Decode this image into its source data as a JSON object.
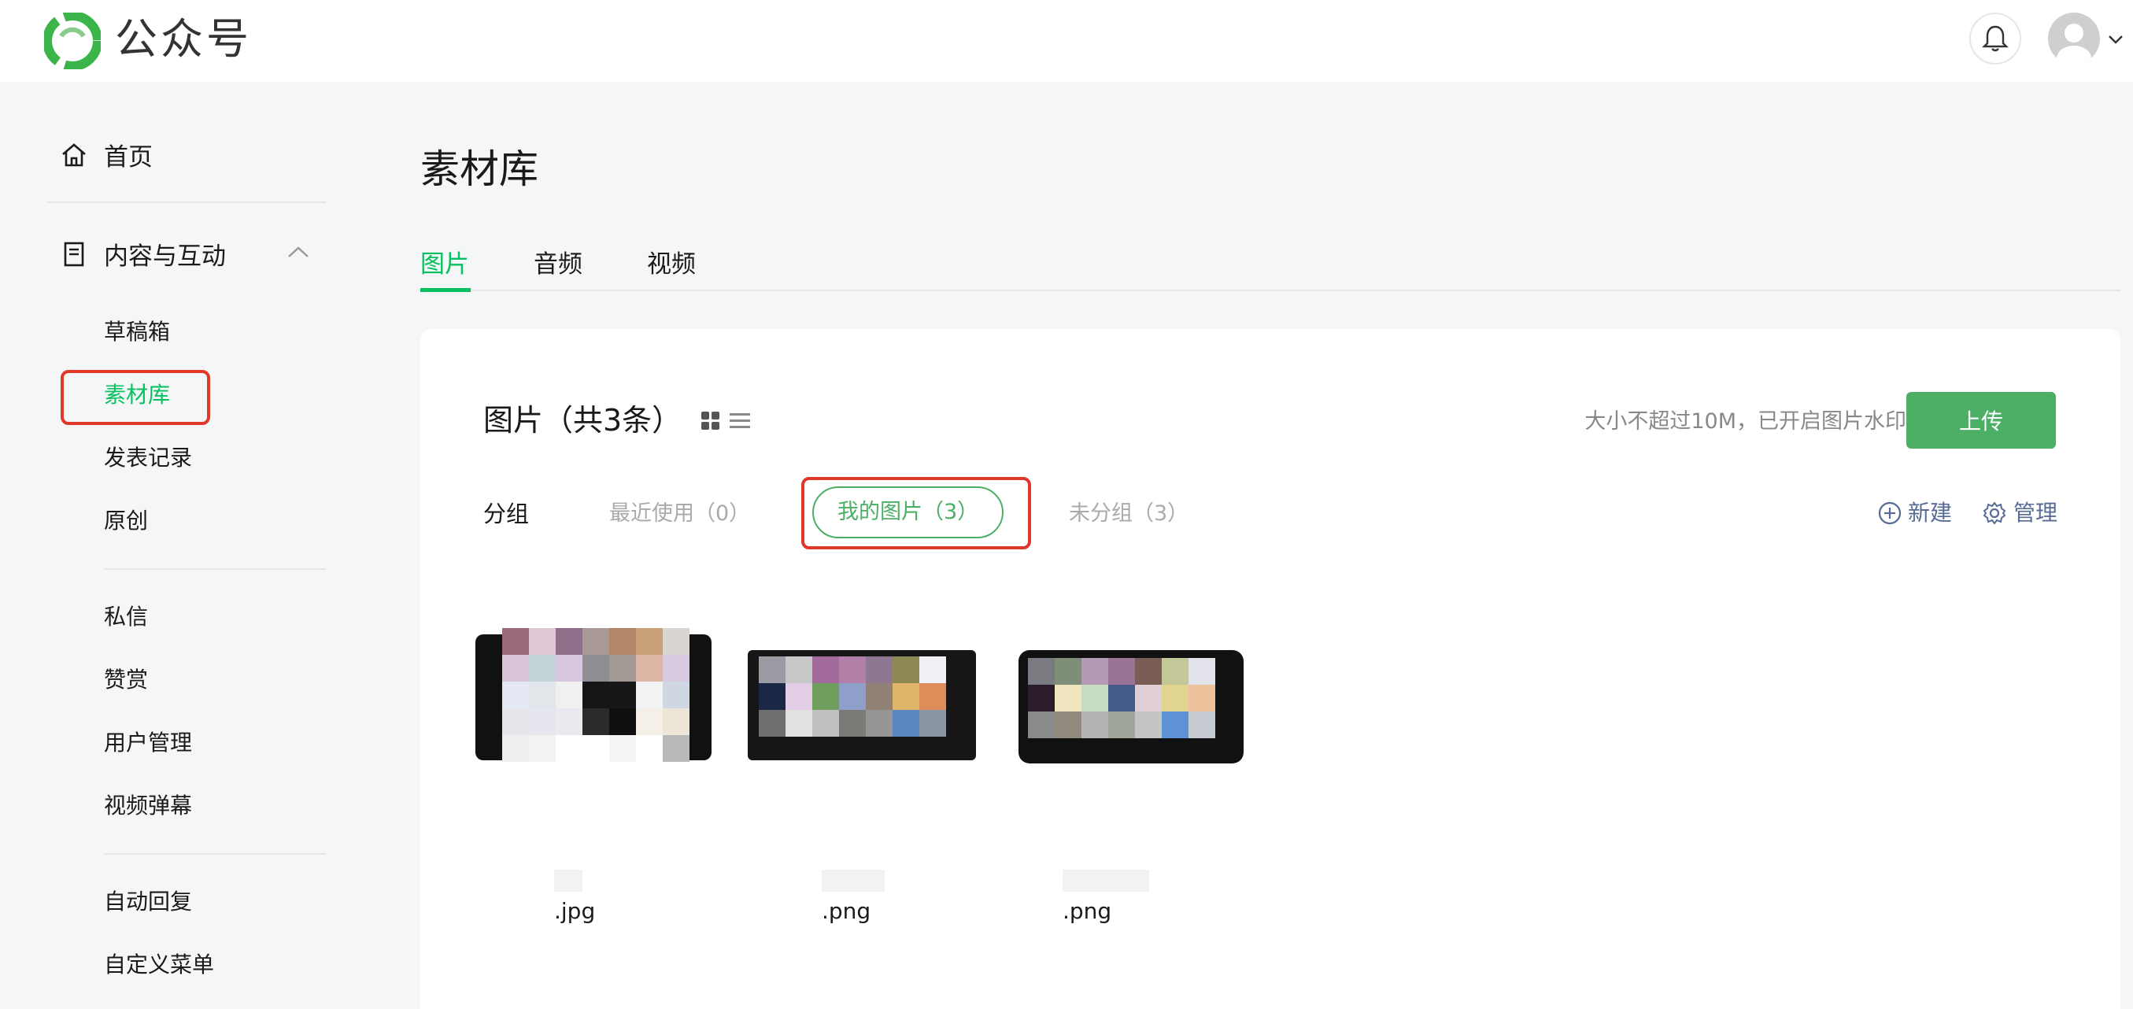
{
  "app": {
    "brand": "公众号",
    "brand_color": "#07c160"
  },
  "topbar": {
    "bell_icon": "bell-icon",
    "avatar_icon": "user-avatar-icon"
  },
  "sidebar": {
    "home": "首页",
    "section": "内容与互动",
    "items_content": [
      "草稿箱",
      "素材库",
      "发表记录",
      "原创"
    ],
    "items_interact": [
      "私信",
      "赞赏",
      "用户管理",
      "视频弹幕"
    ],
    "items_auto": [
      "自动回复",
      "自定义菜单"
    ],
    "active": "素材库"
  },
  "main": {
    "title": "素材库",
    "tabs": [
      "图片",
      "音频",
      "视频"
    ],
    "active_tab": "图片",
    "card_title": "图片（共3条）",
    "hint": "大小不超过10M，已开启图片水印",
    "hint_icon": "?",
    "upload_label": "上传",
    "group_label": "分组",
    "groups": [
      "最近使用（0）",
      "我的图片（3）",
      "未分组（3）"
    ],
    "active_group": "我的图片（3）",
    "actions": {
      "new": "新建",
      "manage": "管理"
    },
    "files": [
      ".jpg",
      ".png",
      ".png"
    ]
  },
  "colors": {
    "accent": "#07c160",
    "upload_btn": "#4caf65",
    "highlight": "#e0392b",
    "link": "#576b95"
  }
}
